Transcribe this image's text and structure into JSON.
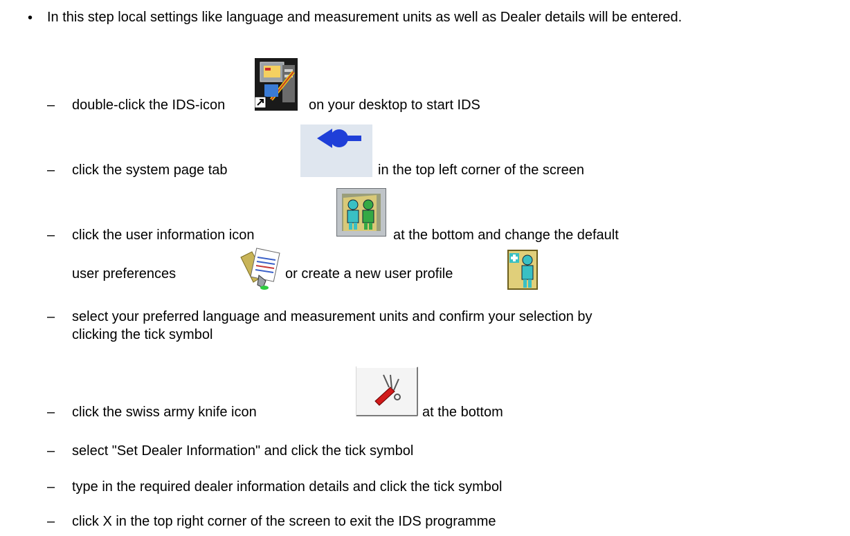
{
  "intro": {
    "bullet": "•",
    "text": "In this step local settings like language and measurement units as well as Dealer details will be entered."
  },
  "dash": "–",
  "steps": {
    "s1": {
      "before": "double-click the IDS-icon",
      "after": "on your desktop to start IDS",
      "icon": "ids-desktop-icon"
    },
    "s2": {
      "before": "click the system page tab",
      "after": "in the top left corner of the screen",
      "icon": "system-page-tab-icon"
    },
    "s3": {
      "before": "click the user information icon",
      "after": "at the bottom and change the default",
      "icon": "user-information-icon"
    },
    "s3b": {
      "before": "user preferences",
      "middle": "or create a new user profile",
      "icon1": "user-preferences-icon",
      "icon2": "new-user-profile-icon"
    },
    "s4": {
      "line1": "select your preferred language and measurement units and confirm your selection by",
      "line2": "clicking the tick symbol"
    },
    "s5": {
      "before": "click the swiss army knife icon",
      "after": "at the bottom",
      "icon": "swiss-army-knife-icon"
    },
    "s6": {
      "text": "select \"Set Dealer Information\" and click the tick symbol"
    },
    "s7": {
      "text": "type in the required dealer information details and click the tick symbol"
    },
    "s8": {
      "text": "click X in the top right corner of the screen to exit the IDS programme"
    }
  }
}
